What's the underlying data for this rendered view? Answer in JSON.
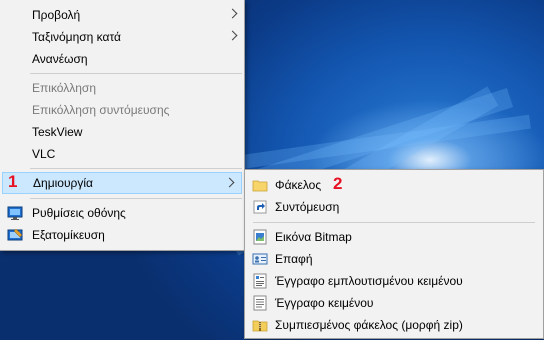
{
  "context_menu": {
    "items": [
      {
        "label": "Προβολή",
        "submenu": true,
        "disabled": false
      },
      {
        "label": "Ταξινόμηση κατά",
        "submenu": true,
        "disabled": false
      },
      {
        "label": "Ανανέωση",
        "submenu": false,
        "disabled": false
      },
      {
        "label": "Επικόλληση",
        "submenu": false,
        "disabled": true
      },
      {
        "label": "Επικόλληση συντόμευσης",
        "submenu": false,
        "disabled": true
      },
      {
        "label": "TeskView",
        "submenu": false,
        "disabled": false
      },
      {
        "label": "VLC",
        "submenu": false,
        "disabled": false
      },
      {
        "label": "Δημιουργία",
        "submenu": true,
        "disabled": false,
        "highlighted": true
      },
      {
        "label": "Ρυθμίσεις οθόνης",
        "icon": "display-settings-icon"
      },
      {
        "label": "Εξατομίκευση",
        "icon": "personalize-icon"
      }
    ]
  },
  "new_submenu": {
    "items": [
      {
        "label": "Φάκελος",
        "icon": "folder-icon"
      },
      {
        "label": "Συντόμευση",
        "icon": "shortcut-icon"
      },
      {
        "label": "Εικόνα Bitmap",
        "icon": "bitmap-icon"
      },
      {
        "label": "Επαφή",
        "icon": "contact-icon"
      },
      {
        "label": "Έγγραφο εμπλουτισμένου κειμένου",
        "icon": "rich-text-document-icon"
      },
      {
        "label": "Έγγραφο κειμένου",
        "icon": "text-document-icon"
      },
      {
        "label": "Συμπιεσμένος φάκελος (μορφή zip)",
        "icon": "zip-folder-icon"
      }
    ]
  },
  "annotations": {
    "step1": "1",
    "step2": "2"
  },
  "colors": {
    "highlight": "#cce8ff",
    "annotation": "#e81123",
    "menu_bg": "#f2f2f2"
  }
}
